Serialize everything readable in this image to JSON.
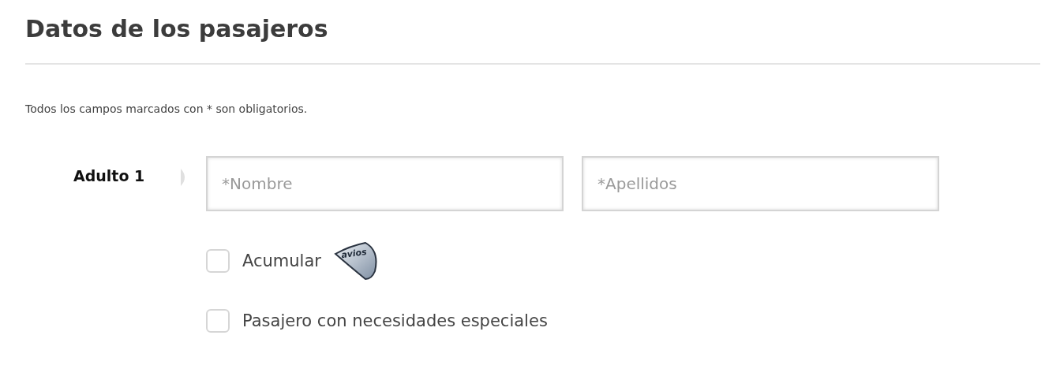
{
  "title": "Datos de los pasajeros",
  "note": "Todos los campos marcados con * son obligatorios.",
  "passengers": [
    {
      "label": "Adulto 1",
      "fields": [
        {
          "placeholder": "*Nombre"
        },
        {
          "placeholder": "*Apellidos"
        }
      ],
      "options": [
        {
          "label": "Acumular",
          "checked": false,
          "badge": "avios"
        },
        {
          "label": "Pasajero con necesidades especiales",
          "checked": false
        }
      ]
    }
  ]
}
